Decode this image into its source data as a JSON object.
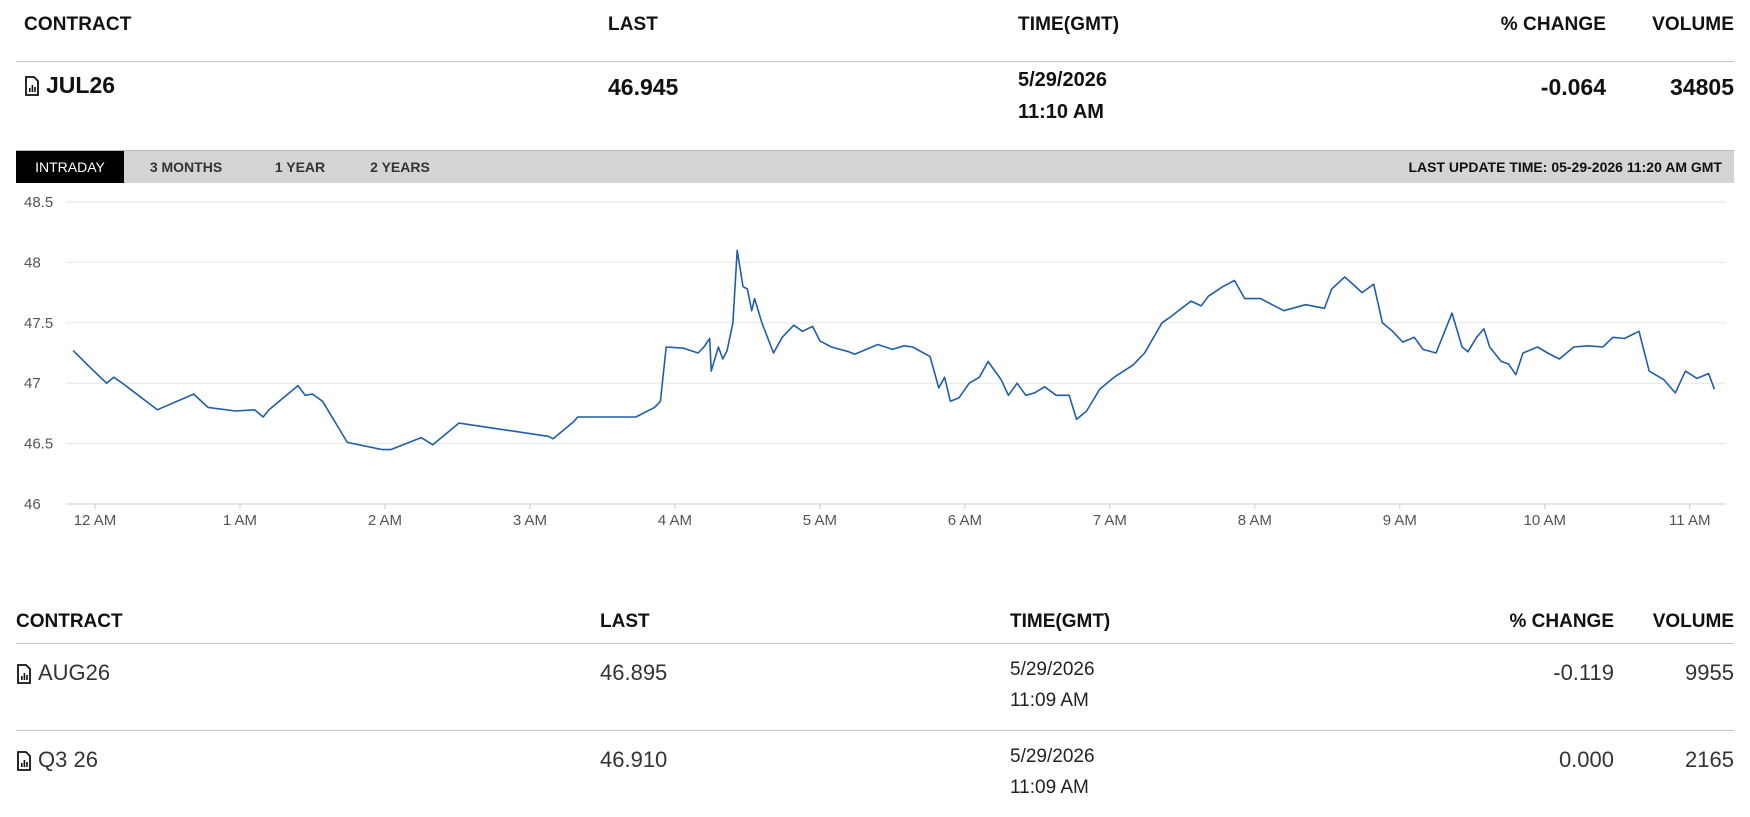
{
  "header": {
    "contract": "CONTRACT",
    "last": "LAST",
    "time": "TIME(GMT)",
    "change": "% CHANGE",
    "volume": "VOLUME"
  },
  "main_contract": {
    "icon": "document-chart-icon",
    "name": "JUL26",
    "last": "46.945",
    "date": "5/29/2026",
    "time": "11:10 AM",
    "change": "-0.064",
    "volume": "34805"
  },
  "tabs": [
    {
      "label": "INTRADAY",
      "active": true
    },
    {
      "label": "3 MONTHS",
      "active": false
    },
    {
      "label": "1 YEAR",
      "active": false
    },
    {
      "label": "2 YEARS",
      "active": false
    }
  ],
  "last_update": "LAST UPDATE TIME: 05-29-2026 11:20 AM GMT",
  "chart_data": {
    "type": "line",
    "color": "#1f5fa8",
    "grid": true,
    "ylim": [
      46,
      48.5
    ],
    "yticks": [
      "48.5",
      "48",
      "47.5",
      "47",
      "46.5",
      "46"
    ],
    "xlim": [
      "-0.2",
      "11.25"
    ],
    "xticks": [
      "12 AM",
      "1 AM",
      "2 AM",
      "3 AM",
      "4 AM",
      "5 AM",
      "6 AM",
      "7 AM",
      "8 AM",
      "9 AM",
      "10 AM",
      "11 AM"
    ],
    "x_unit": "hours after 12 AM GMT",
    "x": [
      -0.15,
      -0.05,
      0.08,
      0.13,
      0.2,
      0.43,
      0.68,
      0.78,
      0.97,
      1.1,
      1.16,
      1.2,
      1.4,
      1.45,
      1.5,
      1.57,
      1.74,
      1.98,
      2.04,
      2.25,
      2.33,
      2.51,
      3.13,
      3.16,
      3.3,
      3.33,
      3.73,
      3.86,
      3.9,
      3.94,
      4.06,
      4.16,
      4.2,
      4.24,
      4.25,
      4.3,
      4.33,
      4.36,
      4.4,
      4.43,
      4.47,
      4.5,
      4.53,
      4.55,
      4.6,
      4.68,
      4.74,
      4.82,
      4.88,
      4.95,
      5.0,
      5.08,
      5.2,
      5.24,
      5.4,
      5.5,
      5.58,
      5.64,
      5.76,
      5.82,
      5.86,
      5.9,
      5.96,
      6.03,
      6.1,
      6.16,
      6.25,
      6.3,
      6.36,
      6.42,
      6.48,
      6.55,
      6.63,
      6.72,
      6.77,
      6.84,
      6.93,
      7.03,
      7.16,
      7.24,
      7.36,
      7.42,
      7.56,
      7.63,
      7.68,
      7.78,
      7.86,
      7.93,
      8.04,
      8.12,
      8.2,
      8.35,
      8.48,
      8.53,
      8.62,
      8.74,
      8.82,
      8.88,
      8.95,
      9.02,
      9.1,
      9.16,
      9.25,
      9.3,
      9.36,
      9.43,
      9.47,
      9.53,
      9.58,
      9.62,
      9.7,
      9.75,
      9.8,
      9.85,
      9.95,
      10.02,
      10.1,
      10.2,
      10.3,
      10.4,
      10.47,
      10.55,
      10.6,
      10.65,
      10.72,
      10.82,
      10.9,
      10.97,
      11.05,
      11.13,
      11.17
    ],
    "values": [
      47.27,
      47.15,
      47.0,
      47.05,
      46.99,
      46.78,
      46.91,
      46.8,
      46.77,
      46.78,
      46.72,
      46.78,
      46.98,
      46.9,
      46.91,
      46.85,
      46.51,
      46.45,
      46.45,
      46.55,
      46.49,
      46.67,
      46.56,
      46.54,
      46.68,
      46.72,
      46.72,
      46.8,
      46.85,
      47.3,
      47.29,
      47.25,
      47.3,
      47.37,
      47.1,
      47.3,
      47.2,
      47.27,
      47.5,
      48.1,
      47.8,
      47.78,
      47.6,
      47.7,
      47.5,
      47.25,
      47.38,
      47.48,
      47.43,
      47.47,
      47.35,
      47.3,
      47.26,
      47.24,
      47.32,
      47.28,
      47.31,
      47.3,
      47.22,
      46.96,
      47.05,
      46.85,
      46.88,
      47.0,
      47.05,
      47.18,
      47.03,
      46.9,
      47.0,
      46.9,
      46.92,
      46.97,
      46.9,
      46.9,
      46.7,
      46.77,
      46.95,
      47.05,
      47.15,
      47.25,
      47.5,
      47.55,
      47.68,
      47.64,
      47.72,
      47.8,
      47.85,
      47.7,
      47.7,
      47.65,
      47.6,
      47.65,
      47.62,
      47.78,
      47.88,
      47.75,
      47.82,
      47.5,
      47.43,
      47.34,
      47.38,
      47.28,
      47.25,
      47.4,
      47.58,
      47.3,
      47.26,
      47.38,
      47.45,
      47.3,
      47.18,
      47.16,
      47.07,
      47.25,
      47.3,
      47.25,
      47.2,
      47.3,
      47.31,
      47.3,
      47.38,
      47.37,
      47.4,
      47.43,
      47.1,
      47.03,
      46.92,
      47.1,
      47.04,
      47.08,
      46.95
    ]
  },
  "lower_header": {
    "contract": "CONTRACT",
    "last": "LAST",
    "time": "TIME(GMT)",
    "change": "% CHANGE",
    "volume": "VOLUME"
  },
  "rows": [
    {
      "name": "AUG26",
      "last": "46.895",
      "date": "5/29/2026",
      "time": "11:09 AM",
      "change": "-0.119",
      "volume": "9955"
    },
    {
      "name": "Q3 26",
      "last": "46.910",
      "date": "5/29/2026",
      "time": "11:09 AM",
      "change": "0.000",
      "volume": "2165"
    }
  ]
}
